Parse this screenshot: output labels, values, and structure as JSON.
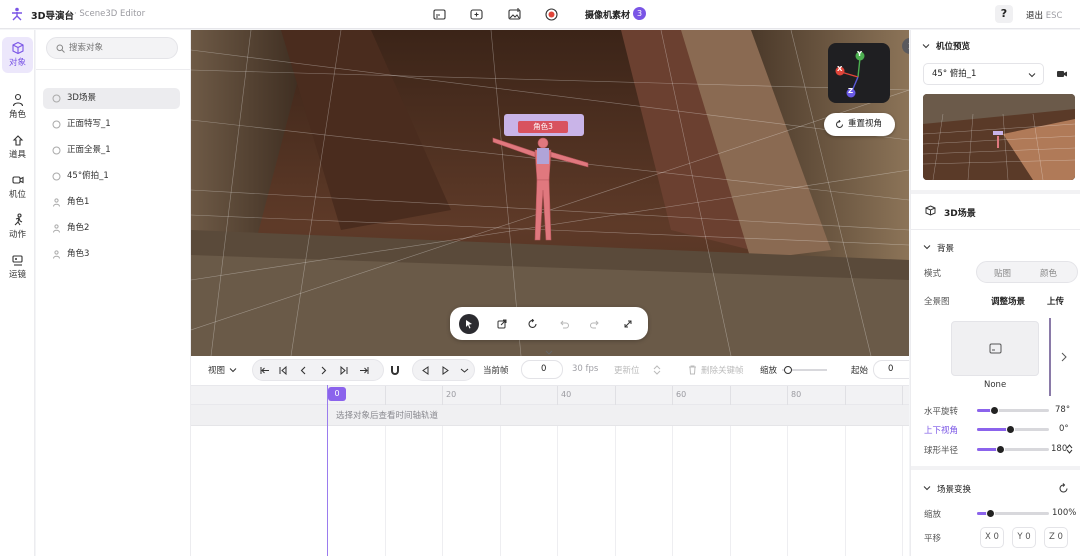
{
  "topbar": {
    "app_name": "3D导演台",
    "editor_name": "· Scene3D Editor",
    "camera_library_label": "摄像机素材",
    "camera_count": "3",
    "help_label": "?",
    "exit_label": "退出",
    "exit_shortcut": "ESC"
  },
  "rail": {
    "items": [
      {
        "label": "对象",
        "icon": "cube-icon"
      },
      {
        "label": "角色",
        "icon": "person-icon"
      },
      {
        "label": "道具",
        "icon": "prop-icon"
      },
      {
        "label": "机位",
        "icon": "camera-icon"
      },
      {
        "label": "动作",
        "icon": "run-icon"
      },
      {
        "label": "运镜",
        "icon": "camera-move-icon"
      }
    ]
  },
  "objects": {
    "search_placeholder": "搜索对象",
    "items": [
      "3D场景",
      "正面特写_1",
      "正面全景_1",
      "45°俯拍_1",
      "角色1",
      "角色2",
      "角色3"
    ]
  },
  "viewport": {
    "character_label": "角色3",
    "reset_view_label": "重置视角",
    "axes": {
      "x": "X",
      "y": "Y",
      "z": "Z"
    }
  },
  "timeline": {
    "view_label": "视图",
    "current_frame_label": "当前帧",
    "current_frame_value": "0",
    "fps": "30 fps",
    "easing": "更新位",
    "delete_keyframe": "删除关键帧",
    "zoom_label": "缩放",
    "start_label": "起始",
    "start_value": "0",
    "ruler": [
      "0",
      "20",
      "40",
      "60",
      "80"
    ],
    "empty_hint": "选择对象后查看时间轴轨道"
  },
  "right_panel": {
    "camera_preview_title": "机位预览",
    "camera_select": "45° 俯拍_1",
    "scene_title": "3D场景",
    "background_title": "背景",
    "mode_label": "模式",
    "mode_options": [
      "贴图",
      "颜色"
    ],
    "panorama_label": "全景图",
    "adjust_scene": "调整场景",
    "upload": "上传",
    "thumb_label": "None",
    "horizontal_label": "水平旋转",
    "horizontal_value": "78°",
    "vertical_label": "上下视角",
    "vertical_value": "0°",
    "radius_label": "球形半径",
    "radius_value": "180",
    "transform_title": "场景变换",
    "scale_label": "缩放",
    "scale_value": "100%",
    "translate_label": "平移",
    "translate_x": "X 0",
    "translate_y": "Y 0",
    "translate_z": "Z 0",
    "slider_levels": {
      "horizontal": 0.25,
      "vertical": 0.47,
      "radius": 0.33,
      "scale": 0.2
    }
  },
  "colors": {
    "accent": "#8b63ec",
    "label_red": "#d8525f"
  }
}
